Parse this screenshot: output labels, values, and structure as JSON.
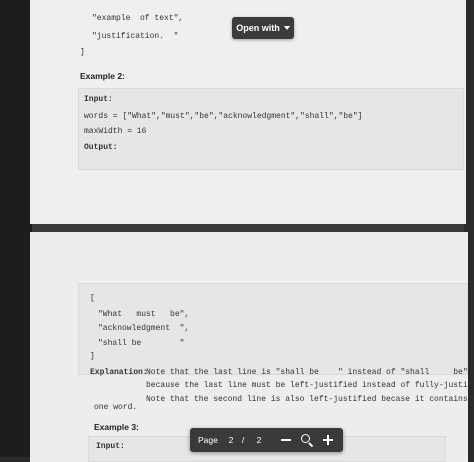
{
  "toolbar_top": {
    "open_with_label": "Open with"
  },
  "page1": {
    "code_tail": [
      "\"example  of text\",",
      "\"justification.  \"",
      "]"
    ],
    "example_heading": "Example 2:",
    "input_label": "Input:",
    "words_line": "words = [\"What\",\"must\",\"be\",\"acknowledgment\",\"shall\",\"be\"]",
    "maxwidth_line": "maxWidth = 16",
    "output_label": "Output:"
  },
  "page2": {
    "output_lines": [
      "[",
      "\"What   must   be\",",
      "\"acknowledgment  \",",
      "\"shall be        \"",
      "]"
    ],
    "explanation_label": "Explanation:",
    "explanation_lines": [
      "Note that the last line is \"shall be    \" instead of \"shall     be\",",
      "because the last line must be left-justified instead of fully-justified.",
      "Note that the second line is also left-justified becase it contains only",
      "one word."
    ],
    "example_heading": "Example 3:",
    "input_label": "Input:"
  },
  "viewer_toolbar": {
    "page_label": "Page",
    "current_page": "2",
    "separator": "/",
    "total_pages": "2"
  }
}
